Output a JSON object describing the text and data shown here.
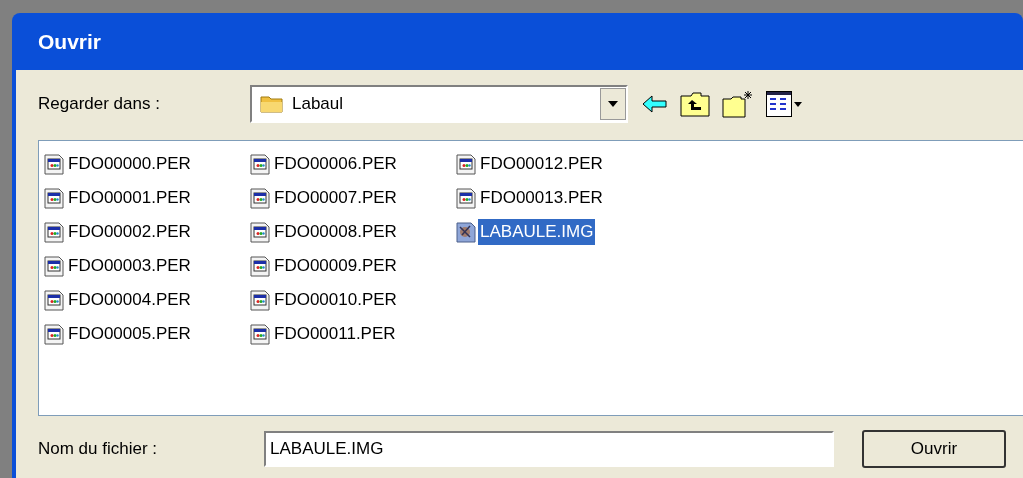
{
  "window": {
    "title": "Ouvrir"
  },
  "look_in": {
    "label": "Regarder dans :",
    "value": "Labaul"
  },
  "file_columns": [
    [
      {
        "name": "FDO00000.PER",
        "kind": "per",
        "selected": false
      },
      {
        "name": "FDO00001.PER",
        "kind": "per",
        "selected": false
      },
      {
        "name": "FDO00002.PER",
        "kind": "per",
        "selected": false
      },
      {
        "name": "FDO00003.PER",
        "kind": "per",
        "selected": false
      },
      {
        "name": "FDO00004.PER",
        "kind": "per",
        "selected": false
      },
      {
        "name": "FDO00005.PER",
        "kind": "per",
        "selected": false
      }
    ],
    [
      {
        "name": "FDO00006.PER",
        "kind": "per",
        "selected": false
      },
      {
        "name": "FDO00007.PER",
        "kind": "per",
        "selected": false
      },
      {
        "name": "FDO00008.PER",
        "kind": "per",
        "selected": false
      },
      {
        "name": "FDO00009.PER",
        "kind": "per",
        "selected": false
      },
      {
        "name": "FDO00010.PER",
        "kind": "per",
        "selected": false
      },
      {
        "name": "FDO00011.PER",
        "kind": "per",
        "selected": false
      }
    ],
    [
      {
        "name": "FDO00012.PER",
        "kind": "per",
        "selected": false
      },
      {
        "name": "FDO00013.PER",
        "kind": "per",
        "selected": false
      },
      {
        "name": "LABAULE.IMG",
        "kind": "img",
        "selected": true
      }
    ]
  ],
  "file_name": {
    "label": "Nom du fichier :",
    "value": "LABAULE.IMG"
  },
  "open_button": "Ouvrir"
}
